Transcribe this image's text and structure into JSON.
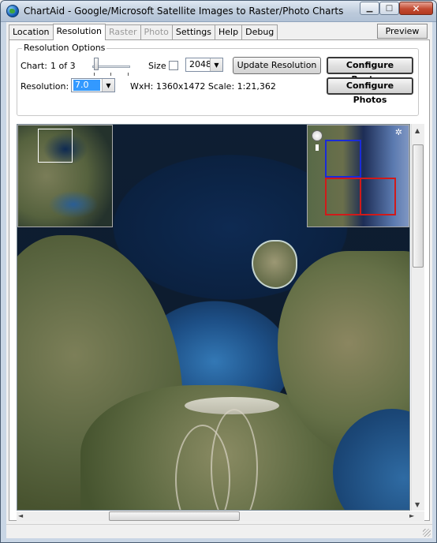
{
  "window": {
    "title": "ChartAid - Google/Microsoft Satellite Images to Raster/Photo Charts",
    "min_glyph": "▁",
    "max_glyph": "□",
    "close_glyph": "✕"
  },
  "tabs": [
    {
      "label": "Location",
      "state": "normal"
    },
    {
      "label": "Resolution",
      "state": "active"
    },
    {
      "label": "Raster",
      "state": "disabled"
    },
    {
      "label": "Photo",
      "state": "disabled"
    },
    {
      "label": "Settings",
      "state": "normal"
    },
    {
      "label": "Help",
      "state": "normal"
    },
    {
      "label": "Debug",
      "state": "normal"
    }
  ],
  "preview_label": "Preview",
  "resolution_options": {
    "legend": "Resolution Options",
    "chart_label": "Chart:",
    "chart_value": "1 of 3",
    "chart_slider_position": 1,
    "chart_slider_count": 3,
    "size_label": "Size",
    "size_checked": false,
    "size_value": "2048",
    "update_button": "Update Resolution",
    "configure_rasters_button": "Configure Rasters",
    "resolution_label": "Resolution:",
    "resolution_value": "7.0",
    "dimensions_text": "WxH: 1360x1472  Scale: 1:21,362",
    "configure_photos_button": "Configure Photos"
  },
  "map": {
    "overview_alt": "overview thumbnail",
    "minimap_alt": "chart layout minimap",
    "minimap_boxes": [
      {
        "color": "#1a2bd8"
      },
      {
        "color": "#d01a1a"
      },
      {
        "color": "#d01a1a"
      }
    ],
    "scroll_up": "▲",
    "scroll_down": "▼",
    "scroll_left": "◄",
    "scroll_right": "►",
    "combo_arrow": "▼"
  }
}
